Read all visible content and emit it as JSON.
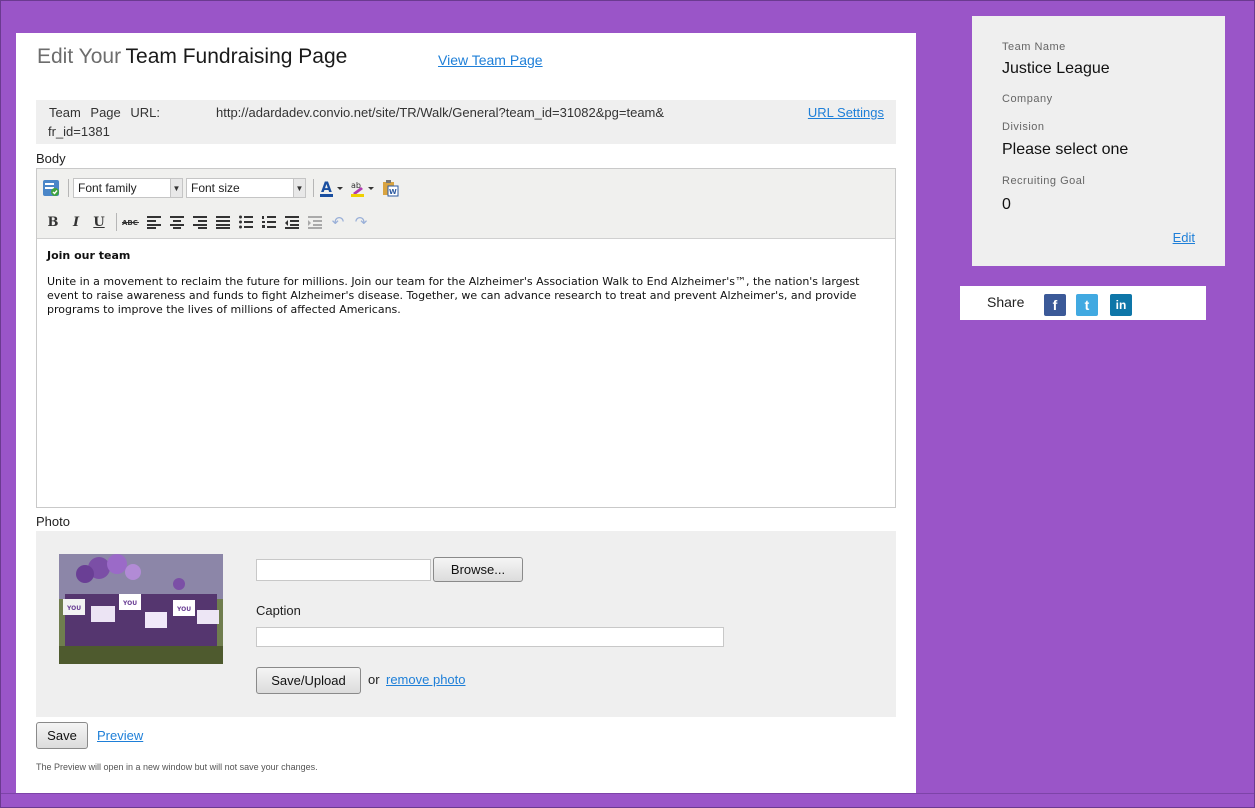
{
  "title": {
    "prefix": "Edit Your",
    "main": "Team Fundraising Page",
    "view_link": "View Team Page"
  },
  "url_box": {
    "label": "Team Page URL:",
    "url_line1": "http://adardadev.convio.net/site/TR/Walk/General?team_id=31082&pg=team&",
    "url_line2": "fr_id=1381",
    "settings_link": "URL Settings"
  },
  "body_section": {
    "label": "Body",
    "toolbar": {
      "font_family": "Font family",
      "font_size": "Font size",
      "icons": [
        "spellcheck-icon",
        "text-color-icon",
        "highlight-icon",
        "paste-word-icon",
        "bold-icon",
        "italic-icon",
        "underline-icon",
        "strikethrough-icon",
        "align-left-icon",
        "align-center-icon",
        "align-right-icon",
        "justify-icon",
        "bullet-list-icon",
        "numbered-list-icon",
        "outdent-icon",
        "indent-icon",
        "undo-icon",
        "redo-icon"
      ]
    },
    "content": {
      "heading": "Join our team",
      "paragraph": "Unite in a movement to reclaim the future for millions. Join our team for the Alzheimer's Association Walk to End Alzheimer's™, the nation's largest event to raise awareness and funds to fight Alzheimer's disease. Together, we can advance research to treat and prevent Alzheimer's, and provide programs to improve the lives of millions of affected Americans."
    }
  },
  "photo_section": {
    "label": "Photo",
    "browse_label": "Browse...",
    "caption_label": "Caption",
    "caption_value": "",
    "file_value": "",
    "save_upload_label": "Save/Upload",
    "or_text": "or",
    "remove_link": "remove photo"
  },
  "actions": {
    "save_label": "Save",
    "preview_link": "Preview",
    "note": "The Preview will open in a new window but will not save your changes."
  },
  "team_info": {
    "team_name_label": "Team Name",
    "team_name": "Justice League",
    "company_label": "Company",
    "division_label": "Division",
    "division_value": "Please select one",
    "goal_label": "Recruiting Goal",
    "goal_value": "0",
    "edit_link": "Edit"
  },
  "share": {
    "label": "Share",
    "icons": [
      "facebook-icon",
      "twitter-icon",
      "linkedin-icon"
    ],
    "facebook_glyph": "f",
    "twitter_glyph": "t",
    "linkedin_glyph": "in"
  },
  "colors": {
    "background": "#9a55c8",
    "link": "#1e7fd8",
    "panel": "#efefef"
  }
}
